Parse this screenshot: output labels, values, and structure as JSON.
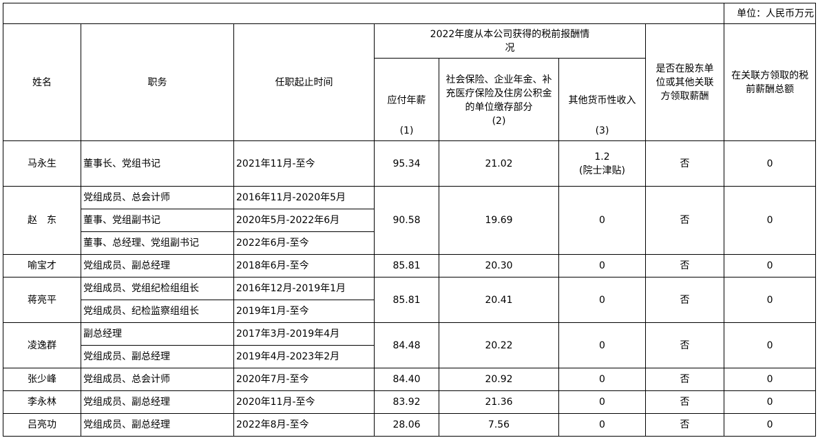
{
  "unit_label": "单位：人民币万元",
  "headers": {
    "name": "姓名",
    "position": "职务",
    "tenure": "任职起止时间",
    "group": "2022年度从本公司获得的税前报酬情况",
    "salary": "应付年薪",
    "salary_no": "(1)",
    "insurance": "社会保险、企业年金、补充医疗保险及住房公积金的单位缴存部分",
    "insurance_no": "(2)",
    "other": "其他货币性收入",
    "other_no": "(3)",
    "related_flag": "是否在股东单位或其他关联方领取薪酬",
    "related_total": "在关联方领取的税前薪酬总额"
  },
  "rows": [
    {
      "name": "马永生",
      "roles": [
        {
          "position": "董事长、党组书记",
          "tenure": "2021年11月-至今"
        }
      ],
      "salary": "95.34",
      "insurance": "21.02",
      "other": "1.2",
      "other_note": "(院士津贴)",
      "related_flag": "否",
      "related_total": "0"
    },
    {
      "name": "赵　东",
      "roles": [
        {
          "position": "党组成员、总会计师",
          "tenure": "2016年11月-2020年5月"
        },
        {
          "position": "董事、党组副书记",
          "tenure": "2020年5月-2022年6月"
        },
        {
          "position": "董事、总经理、党组副书记",
          "tenure": "2022年6月-至今"
        }
      ],
      "salary": "90.58",
      "insurance": "19.69",
      "other": "0",
      "related_flag": "否",
      "related_total": "0"
    },
    {
      "name": "喻宝才",
      "roles": [
        {
          "position": "党组成员、副总经理",
          "tenure": "2018年6月-至今"
        }
      ],
      "salary": "85.81",
      "insurance": "20.30",
      "other": "0",
      "related_flag": "否",
      "related_total": "0"
    },
    {
      "name": "蒋亮平",
      "roles": [
        {
          "position": "党组成员、党组纪检组组长",
          "tenure": "2016年12月-2019年1月"
        },
        {
          "position": "党组成员、纪检监察组组长",
          "tenure": "2019年1月-至今"
        }
      ],
      "salary": "85.81",
      "insurance": "20.41",
      "other": "0",
      "related_flag": "否",
      "related_total": "0"
    },
    {
      "name": "凌逸群",
      "roles": [
        {
          "position": "副总经理",
          "tenure": "2017年3月-2019年4月"
        },
        {
          "position": "党组成员、副总经理",
          "tenure": "2019年4月-2023年2月"
        }
      ],
      "salary": "84.48",
      "insurance": "20.22",
      "other": "0",
      "related_flag": "否",
      "related_total": "0"
    },
    {
      "name": "张少峰",
      "roles": [
        {
          "position": "党组成员、总会计师",
          "tenure": "2020年7月-至今"
        }
      ],
      "salary": "84.40",
      "insurance": "20.92",
      "other": "0",
      "related_flag": "否",
      "related_total": "0"
    },
    {
      "name": "李永林",
      "roles": [
        {
          "position": "党组成员、副总经理",
          "tenure": "2020年11月-至今"
        }
      ],
      "salary": "83.92",
      "insurance": "21.36",
      "other": "0",
      "related_flag": "否",
      "related_total": "0"
    },
    {
      "name": "吕亮功",
      "roles": [
        {
          "position": "党组成员、副总经理",
          "tenure": "2022年8月-至今"
        }
      ],
      "salary": "28.06",
      "insurance": "7.56",
      "other": "0",
      "related_flag": "否",
      "related_total": "0"
    }
  ]
}
